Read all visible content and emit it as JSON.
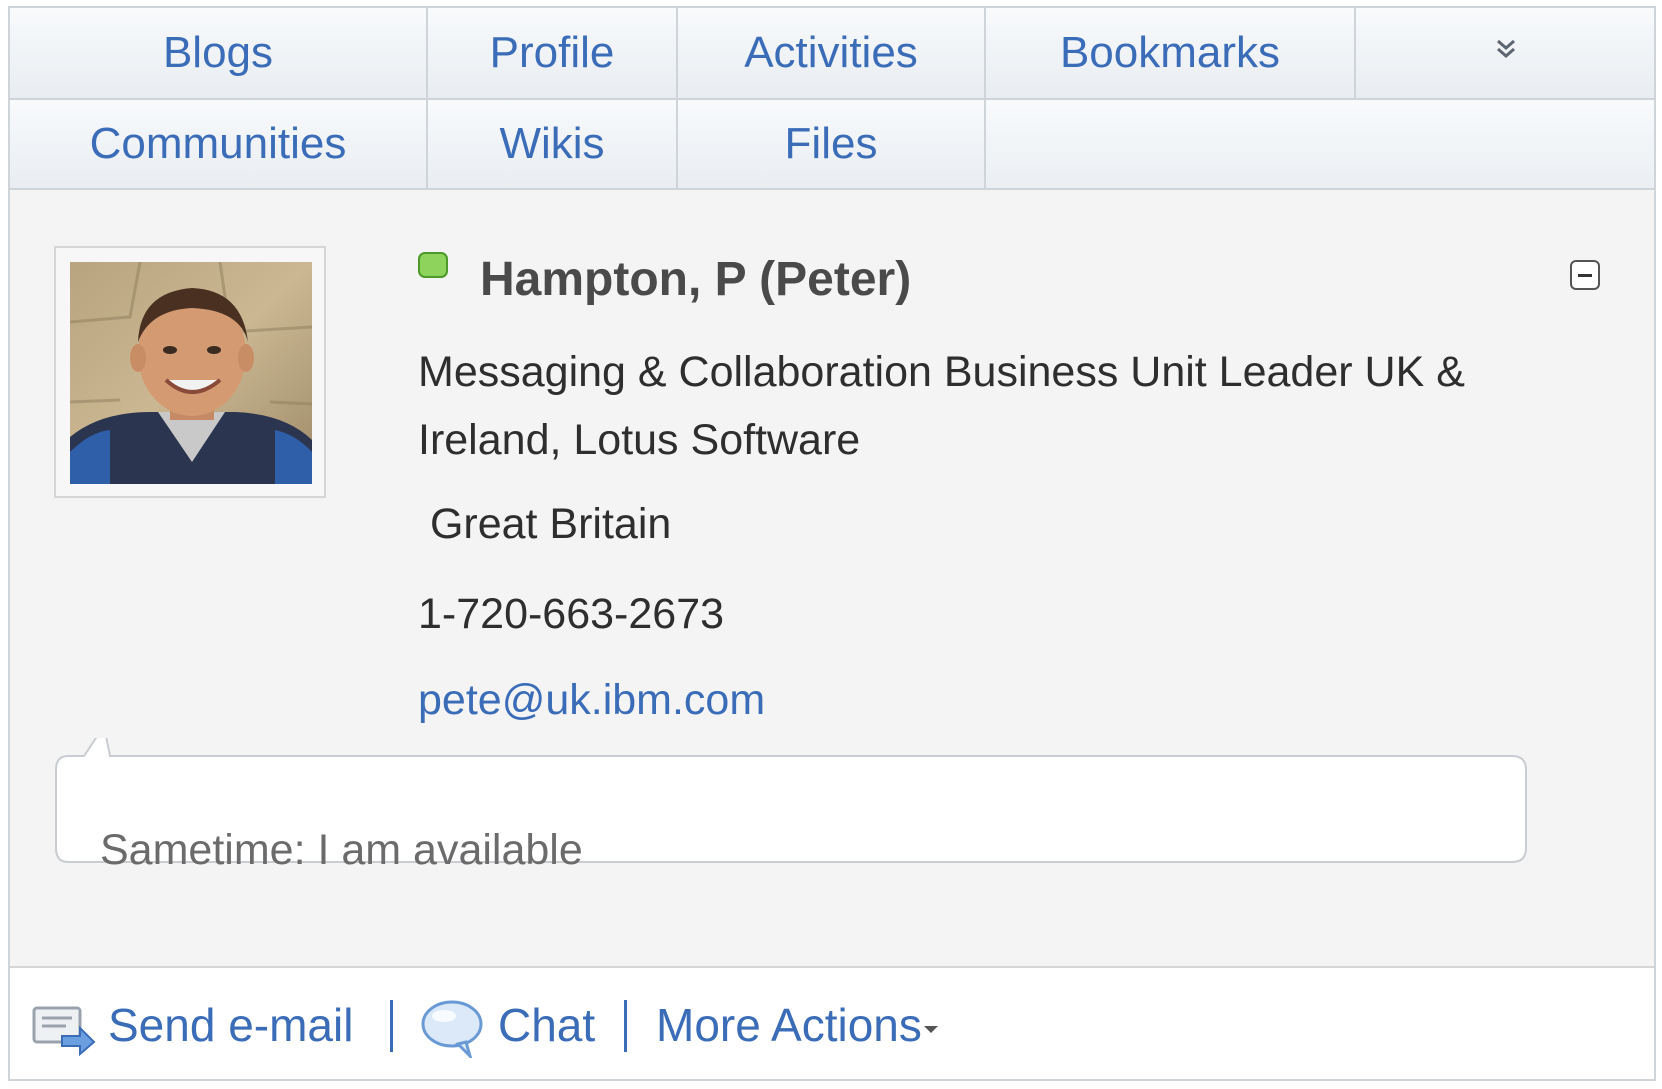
{
  "tabs": {
    "row1": [
      "Blogs",
      "Profile",
      "Activities",
      "Bookmarks"
    ],
    "more_icon": "double-chevron-down",
    "row2": [
      "Communities",
      "Wikis",
      "Files"
    ]
  },
  "person": {
    "name": "Hampton, P (Peter)",
    "job_title": "Messaging & Collaboration Business Unit Leader UK & Ireland, Lotus Software",
    "location": " Great Britain",
    "phone": "1-720-663-2673",
    "email": "pete@uk.ibm.com",
    "status_color": "#8ed45c"
  },
  "status_message": "Sametime: I am available",
  "footer": {
    "send_email": "Send e-mail",
    "chat": "Chat",
    "more_actions": "More Actions"
  },
  "colors": {
    "link": "#3a6cb8",
    "background": "#f4f4f4",
    "border": "#cfd4d9"
  }
}
